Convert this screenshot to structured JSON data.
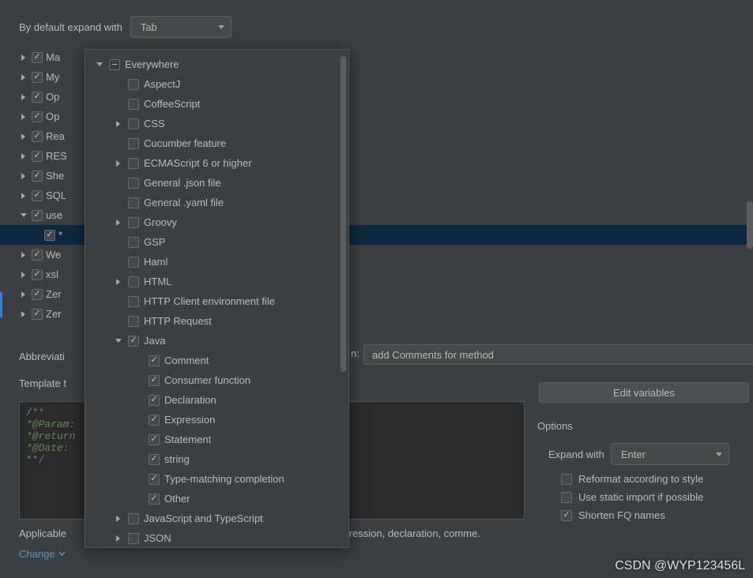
{
  "top": {
    "label": "By default expand with",
    "combo_value": "Tab"
  },
  "tree": {
    "items": [
      {
        "label": "Ma",
        "arrow": "r"
      },
      {
        "label": "My",
        "arrow": "r"
      },
      {
        "label": "Op",
        "arrow": "r"
      },
      {
        "label": "Op",
        "arrow": "r"
      },
      {
        "label": "Rea",
        "arrow": "r"
      },
      {
        "label": "RES",
        "arrow": "r"
      },
      {
        "label": "She",
        "arrow": "r"
      },
      {
        "label": "SQL",
        "arrow": "r"
      },
      {
        "label": "use",
        "arrow": "d"
      },
      {
        "label": "*",
        "arrow": "",
        "selected": true,
        "indent": true
      },
      {
        "label": "We",
        "arrow": "r"
      },
      {
        "label": "xsl",
        "arrow": "r"
      },
      {
        "label": "Zer",
        "arrow": "r"
      },
      {
        "label": "Zer",
        "arrow": "r"
      }
    ]
  },
  "popup": {
    "items": [
      {
        "l": 1,
        "arrow": "d",
        "box": "minus",
        "label": "Everywhere"
      },
      {
        "l": 2,
        "arrow": "",
        "box": "u",
        "label": "AspectJ"
      },
      {
        "l": 2,
        "arrow": "",
        "box": "u",
        "label": "CoffeeScript"
      },
      {
        "l": 2,
        "arrow": "r",
        "box": "u",
        "label": "CSS"
      },
      {
        "l": 2,
        "arrow": "",
        "box": "u",
        "label": "Cucumber feature"
      },
      {
        "l": 2,
        "arrow": "r",
        "box": "u",
        "label": "ECMAScript 6 or higher"
      },
      {
        "l": 2,
        "arrow": "",
        "box": "u",
        "label": "General .json file"
      },
      {
        "l": 2,
        "arrow": "",
        "box": "u",
        "label": "General .yaml file"
      },
      {
        "l": 2,
        "arrow": "r",
        "box": "u",
        "label": "Groovy"
      },
      {
        "l": 2,
        "arrow": "",
        "box": "u",
        "label": "GSP"
      },
      {
        "l": 2,
        "arrow": "",
        "box": "u",
        "label": "Haml"
      },
      {
        "l": 2,
        "arrow": "r",
        "box": "u",
        "label": "HTML"
      },
      {
        "l": 2,
        "arrow": "",
        "box": "u",
        "label": "HTTP Client environment file"
      },
      {
        "l": 2,
        "arrow": "",
        "box": "u",
        "label": "HTTP Request"
      },
      {
        "l": 2,
        "arrow": "d",
        "box": "c",
        "label": "Java"
      },
      {
        "l": 3,
        "arrow": "",
        "box": "c",
        "label": "Comment"
      },
      {
        "l": 3,
        "arrow": "",
        "box": "c",
        "label": "Consumer function"
      },
      {
        "l": 3,
        "arrow": "",
        "box": "c",
        "label": "Declaration"
      },
      {
        "l": 3,
        "arrow": "",
        "box": "c",
        "label": "Expression"
      },
      {
        "l": 3,
        "arrow": "",
        "box": "c",
        "label": "Statement"
      },
      {
        "l": 3,
        "arrow": "",
        "box": "c",
        "label": "string"
      },
      {
        "l": 3,
        "arrow": "",
        "box": "c",
        "label": "Type-matching completion"
      },
      {
        "l": 3,
        "arrow": "",
        "box": "c",
        "label": "Other"
      },
      {
        "l": 2,
        "arrow": "r",
        "box": "u",
        "label": "JavaScript and TypeScript"
      },
      {
        "l": 2,
        "arrow": "r",
        "box": "u",
        "label": "JSON"
      }
    ]
  },
  "form": {
    "abbrev_label": "Abbreviati",
    "desc_suffix": "n:",
    "desc_value": "add  Comments  for method",
    "template_label": "Template t",
    "edit_variables": "Edit variables"
  },
  "code": {
    "l1": "/**",
    "l2": "*@Param:",
    "l3": "*@return",
    "l4": "*@Date:",
    "l5": "**/"
  },
  "options": {
    "title": "Options",
    "expand_label": "Expand with",
    "expand_value": "Enter",
    "opt1": "Reformat according to style",
    "opt2": "Use static import if possible",
    "opt3": "Shorten FQ names"
  },
  "applicable": {
    "prefix": "Applicable",
    "rest": "xpression, declaration, comme."
  },
  "change_link": "Change",
  "watermark": "CSDN @WYP123456L"
}
